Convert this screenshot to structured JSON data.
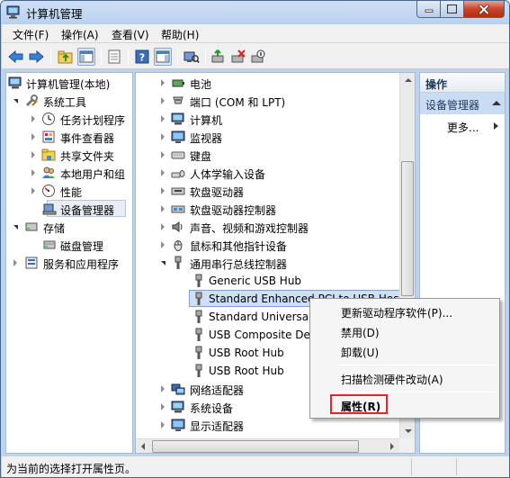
{
  "window": {
    "title": "计算机管理",
    "controls": {
      "minimize": "—",
      "maximize": "☐",
      "close": "✕"
    }
  },
  "menubar": {
    "items": [
      "文件(F)",
      "操作(A)",
      "查看(V)",
      "帮助(H)"
    ]
  },
  "left_tree": {
    "items": [
      {
        "label": "计算机管理(本地)",
        "icon": "computer-management-icon"
      },
      {
        "label": "系统工具",
        "icon": "tools-icon"
      },
      {
        "label": "任务计划程序",
        "icon": "clock-icon"
      },
      {
        "label": "事件查看器",
        "icon": "event-viewer-icon"
      },
      {
        "label": "共享文件夹",
        "icon": "shared-folder-icon"
      },
      {
        "label": "本地用户和组",
        "icon": "users-icon"
      },
      {
        "label": "性能",
        "icon": "performance-icon"
      },
      {
        "label": "设备管理器",
        "icon": "device-manager-icon"
      },
      {
        "label": "存储",
        "icon": "storage-icon"
      },
      {
        "label": "磁盘管理",
        "icon": "disk-icon"
      },
      {
        "label": "服务和应用程序",
        "icon": "services-icon"
      }
    ]
  },
  "device_tree": {
    "items": [
      {
        "label": "电池",
        "icon": "battery-icon"
      },
      {
        "label": "端口 (COM 和 LPT)",
        "icon": "port-icon"
      },
      {
        "label": "计算机",
        "icon": "computer-icon"
      },
      {
        "label": "监视器",
        "icon": "monitor-icon"
      },
      {
        "label": "键盘",
        "icon": "keyboard-icon"
      },
      {
        "label": "人体学输入设备",
        "icon": "hid-icon"
      },
      {
        "label": "软盘驱动器",
        "icon": "floppy-icon"
      },
      {
        "label": "软盘驱动器控制器",
        "icon": "floppy-controller-icon"
      },
      {
        "label": "声音、视频和游戏控制器",
        "icon": "sound-icon"
      },
      {
        "label": "鼠标和其他指针设备",
        "icon": "mouse-icon"
      },
      {
        "label": "通用串行总线控制器",
        "icon": "usb-icon"
      },
      {
        "label": "Generic USB Hub",
        "icon": "usb-device-icon"
      },
      {
        "label": "Standard Enhanced PCI to USB Host Controller",
        "icon": "usb-device-icon"
      },
      {
        "label": "Standard Universal",
        "icon": "usb-device-icon"
      },
      {
        "label": "USB Composite Dev",
        "icon": "usb-device-icon"
      },
      {
        "label": "USB Root Hub",
        "icon": "usb-device-icon"
      },
      {
        "label": "USB Root Hub",
        "icon": "usb-device-icon"
      },
      {
        "label": "网络适配器",
        "icon": "network-adapter-icon"
      },
      {
        "label": "系统设备",
        "icon": "system-device-icon"
      },
      {
        "label": "显示适配器",
        "icon": "display-adapter-icon"
      }
    ]
  },
  "actions": {
    "header": "操作",
    "section": "设备管理器",
    "more": "更多..."
  },
  "context_menu": {
    "items": [
      "更新驱动程序软件(P)...",
      "禁用(D)",
      "卸载(U)",
      "扫描检测硬件改动(A)",
      "属性(R)"
    ]
  },
  "statusbar": {
    "text": "为当前的选择打开属性页。"
  },
  "colors": {
    "accent_highlight": "#e02828",
    "selection": "#cde0f6"
  }
}
